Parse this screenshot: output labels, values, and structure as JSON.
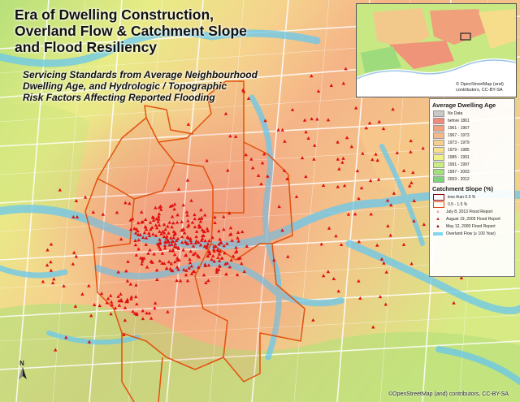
{
  "title_lines": [
    "Era of Dwelling Construction,",
    "Overland Flow & Catchment Slope",
    "and Flood Resiliency"
  ],
  "subtitle_lines": [
    "Servicing Standards from Average Neighbourhood",
    "Dwelling Age, and Hydrologic / Topographic",
    "Risk Factors Affecting Reported Flooding"
  ],
  "inset": {
    "credit_lines": [
      "© OpenStreetMap (and)",
      "contributors, CC-BY-SA"
    ]
  },
  "legend": {
    "dwelling_heading": "Average Dwelling Age",
    "dwelling_classes": [
      {
        "label": "No Data",
        "color": "#c8c8c8"
      },
      {
        "label": "before 1861",
        "color": "#f08a7a"
      },
      {
        "label": "1961 - 1967",
        "color": "#f2a27f"
      },
      {
        "label": "1967 - 1973",
        "color": "#f6b98a"
      },
      {
        "label": "1973 - 1979",
        "color": "#f8ce8e"
      },
      {
        "label": "1979 - 1985",
        "color": "#f8e08c"
      },
      {
        "label": "1985 - 1991",
        "color": "#eef08a"
      },
      {
        "label": "1991 - 1997",
        "color": "#c9ec84"
      },
      {
        "label": "1997 - 2003",
        "color": "#a2e07e"
      },
      {
        "label": "2003 - 2012",
        "color": "#7fd277"
      }
    ],
    "slope_heading": "Catchment Slope (%)",
    "slope_classes": [
      {
        "label": "less than 0.5 %",
        "color": "#8b0000"
      },
      {
        "label": "0.5 - 1.5 %",
        "color": "#e84a1a"
      }
    ],
    "flood_reports": [
      {
        "label": "July 8, 2013 Flood Report",
        "color": "#f3a3a3"
      },
      {
        "label": "August 19, 2005 Flood Report",
        "color": "#e02020"
      },
      {
        "label": "May 12, 2000 Flood Report",
        "color": "#a01010"
      }
    ],
    "overland_flow": {
      "label": "Overland Flow (≥ 100 Year)",
      "color": "#7ed6f0"
    }
  },
  "north_arrow": "N",
  "footer_credit": "©OpenStreetMap (and) contributors, CC-BY-SA",
  "colors": {
    "catchment_outline": "#e2520f",
    "flood_marker": "#e01010",
    "overland_flow": "#68c8ee",
    "road": "#ffffff"
  }
}
